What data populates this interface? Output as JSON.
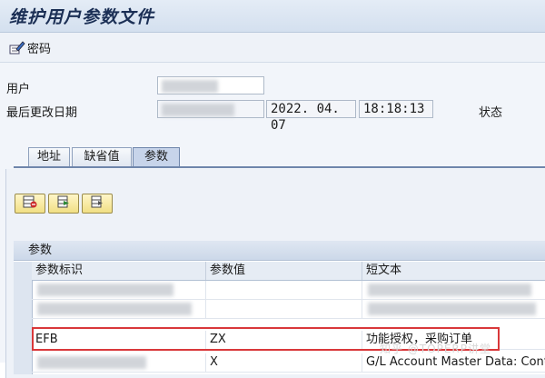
{
  "window": {
    "title": "维护用户参数文件"
  },
  "toolbar": {
    "password_label": "密码"
  },
  "header": {
    "user_label": "用户",
    "last_changed_label": "最后更改日期",
    "date": "2022. 04. 07",
    "time": "18:18:13",
    "status_label": "状态"
  },
  "tabs": [
    {
      "label": "地址",
      "active": false
    },
    {
      "label": "缺省值",
      "active": false
    },
    {
      "label": "参数",
      "active": true
    }
  ],
  "buttons": [
    "delete-row-icon",
    "insert-row-icon",
    "select-row-icon"
  ],
  "grid": {
    "title": "参数",
    "columns": [
      "参数标识",
      "参数值",
      "短文本"
    ],
    "rows": [
      {
        "id": "",
        "value": "",
        "text": "",
        "blurred": true
      },
      {
        "id": "",
        "value": "",
        "text": "",
        "blurred": true
      },
      {
        "id": "EFB",
        "value": "ZX",
        "text": "功能授权，采购订单",
        "blurred": false
      },
      {
        "id": "",
        "value": "X",
        "text": "G/L Account Master Data: Contro",
        "blurred": false,
        "id_blurred": true
      }
    ]
  },
  "watermark": "知乎 @TOPERP讲堂",
  "colors": {
    "highlight": "#d9383a",
    "tab_active": "#c7d4ea",
    "button_yellow": "#f1df84"
  }
}
